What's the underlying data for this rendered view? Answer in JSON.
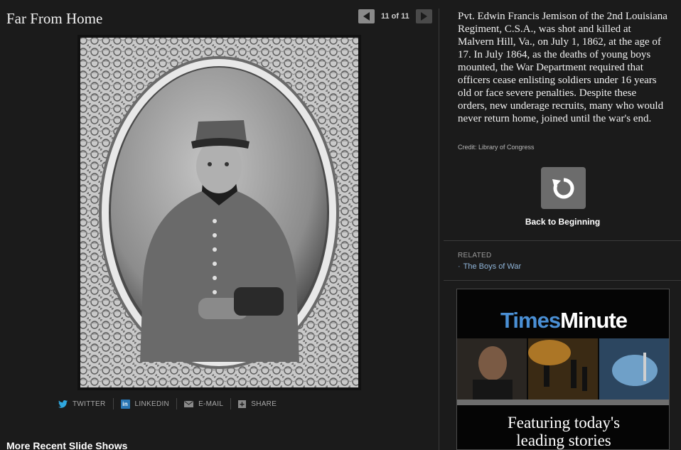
{
  "slideshow": {
    "title": "Far From Home",
    "pager": {
      "prev_icon": "left-arrow-icon",
      "counter": "11 of 11",
      "next_icon": "right-arrow-icon"
    }
  },
  "share": {
    "twitter": "TWITTER",
    "linkedin_icon_text": "in",
    "linkedin": "LINKEDIN",
    "email": "E-MAIL",
    "share": "SHARE"
  },
  "more": {
    "title": "More Recent Slide Shows"
  },
  "caption": {
    "text": "Pvt. Edwin Francis Jemison of the 2nd Louisiana Regiment, C.S.A., was shot and killed at Malvern Hill, Va., on July 1, 1862, at the age of 17. In July 1864, as the deaths of young boys mounted, the War Department required that officers cease enlisting soldiers under 16 years old or face severe penalties. Despite these orders, new underage recruits, many who would never return home, joined until the war's end.",
    "credit": "Credit: Library of Congress"
  },
  "back": {
    "label": "Back to Beginning",
    "icon": "restart-icon"
  },
  "related": {
    "label": "RELATED",
    "link": "The Boys of War"
  },
  "ad": {
    "logo_times": "Times",
    "logo_minute": "Minute",
    "tagline_line1": "Featuring today's",
    "tagline_line2": "leading stories"
  },
  "colors": {
    "background": "#1b1b1b",
    "link": "#8fb4d8",
    "ad_blue": "#4a8fd4"
  }
}
